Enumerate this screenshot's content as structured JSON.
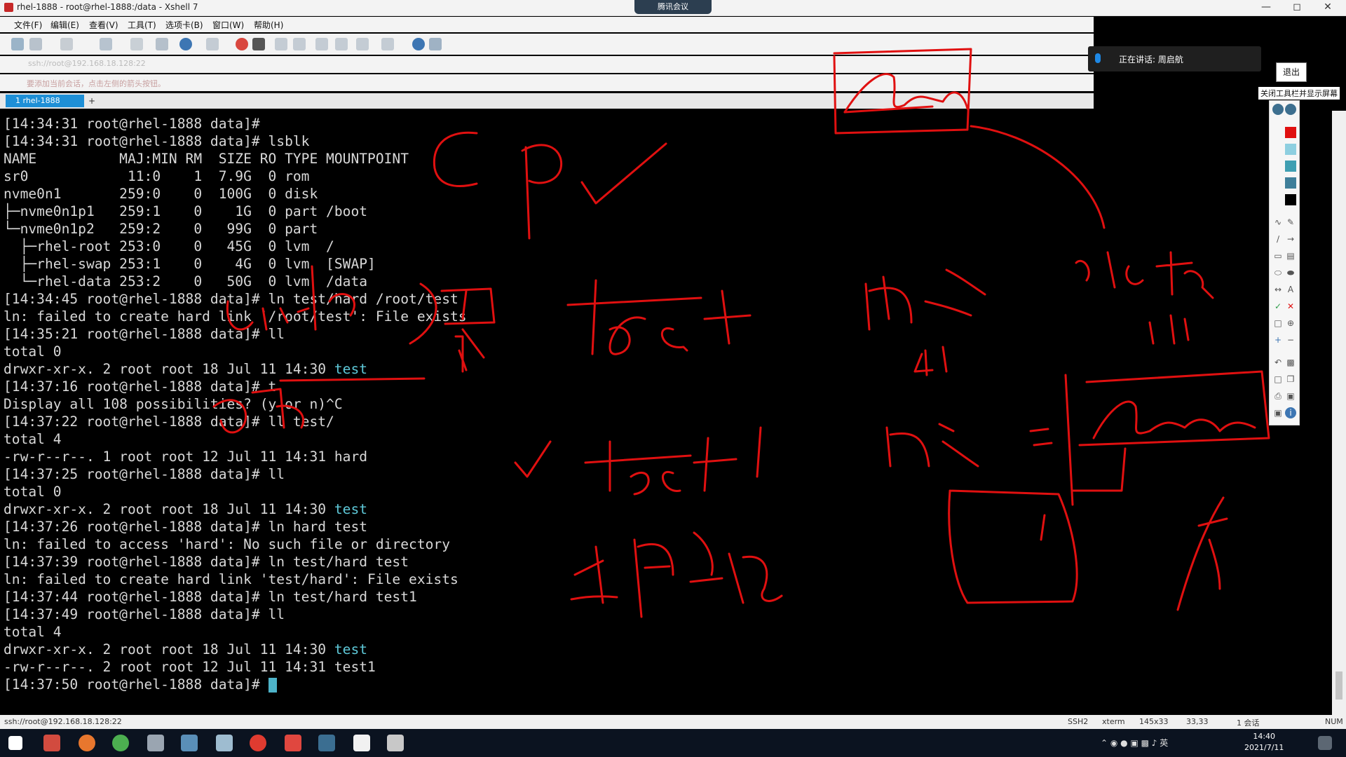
{
  "window": {
    "title": "rhel-1888 - root@rhel-1888:/data - Xshell 7",
    "meeting_badge": "腾讯会议"
  },
  "menu": [
    "文件(F)",
    "编辑(E)",
    "查看(V)",
    "工具(T)",
    "选项卡(B)",
    "窗口(W)",
    "帮助(H)"
  ],
  "address": "ssh://root@192.168.18.128:22",
  "hint": "要添加当前会话，点击左侧的箭头按钮。",
  "tabs": [
    {
      "label": "1 rhel-1888"
    }
  ],
  "terminal": {
    "lines": [
      "[14:34:31 root@rhel-1888 data]#",
      "[14:34:31 root@rhel-1888 data]# lsblk",
      "NAME          MAJ:MIN RM  SIZE RO TYPE MOUNTPOINT",
      "sr0            11:0    1  7.9G  0 rom",
      "nvme0n1       259:0    0  100G  0 disk",
      "├─nvme0n1p1   259:1    0    1G  0 part /boot",
      "└─nvme0n1p2   259:2    0   99G  0 part",
      "  ├─rhel-root 253:0    0   45G  0 lvm  /",
      "  ├─rhel-swap 253:1    0    4G  0 lvm  [SWAP]",
      "  └─rhel-data 253:2    0   50G  0 lvm  /data",
      "[14:34:45 root@rhel-1888 data]# ln test/hard /root/test",
      "ln: failed to create hard link '/root/test': File exists",
      "[14:35:21 root@rhel-1888 data]# ll",
      "total 0",
      "drwxr-xr-x. 2 root root 18 Jul 11 14:30 ",
      "[14:37:16 root@rhel-1888 data]# t",
      "Display all 108 possibilities? (y or n)^C",
      "[14:37:22 root@rhel-1888 data]# ll test/",
      "total 4",
      "-rw-r--r--. 1 root root 12 Jul 11 14:31 hard",
      "[14:37:25 root@rhel-1888 data]# ll",
      "total 0",
      "drwxr-xr-x. 2 root root 18 Jul 11 14:30 ",
      "[14:37:26 root@rhel-1888 data]# ln hard test",
      "ln: failed to access 'hard': No such file or directory",
      "[14:37:39 root@rhel-1888 data]# ln test/hard test",
      "ln: failed to create hard link 'test/hard': File exists",
      "[14:37:44 root@rhel-1888 data]# ln test/hard test1",
      "[14:37:49 root@rhel-1888 data]# ll",
      "total 4",
      "drwxr-xr-x. 2 root root 18 Jul 11 14:30 ",
      "-rw-r--r--. 2 root root 12 Jul 11 14:31 test1",
      "[14:37:50 root@rhel-1888 data]# "
    ],
    "dir_name": "test"
  },
  "meeting": {
    "speaking": "正在讲话: 周启航",
    "exit": "退出",
    "tooltip": "关闭工具栏并显示屏幕"
  },
  "statusbar": {
    "connection": "ssh://root@192.168.18.128:22",
    "protocol": "SSH2",
    "term": "xterm",
    "size": "145x33",
    "pos": "33,33",
    "sessions": "1 会话",
    "caps": "NUM"
  },
  "taskbar": {
    "time": "14:40",
    "date": "2021/7/11",
    "ime": "英"
  },
  "colors": {
    "ink": "#e01010",
    "terminal_bg": "#000000",
    "dir": "#5ec8d8",
    "tab_active": "#1e8fd6"
  }
}
